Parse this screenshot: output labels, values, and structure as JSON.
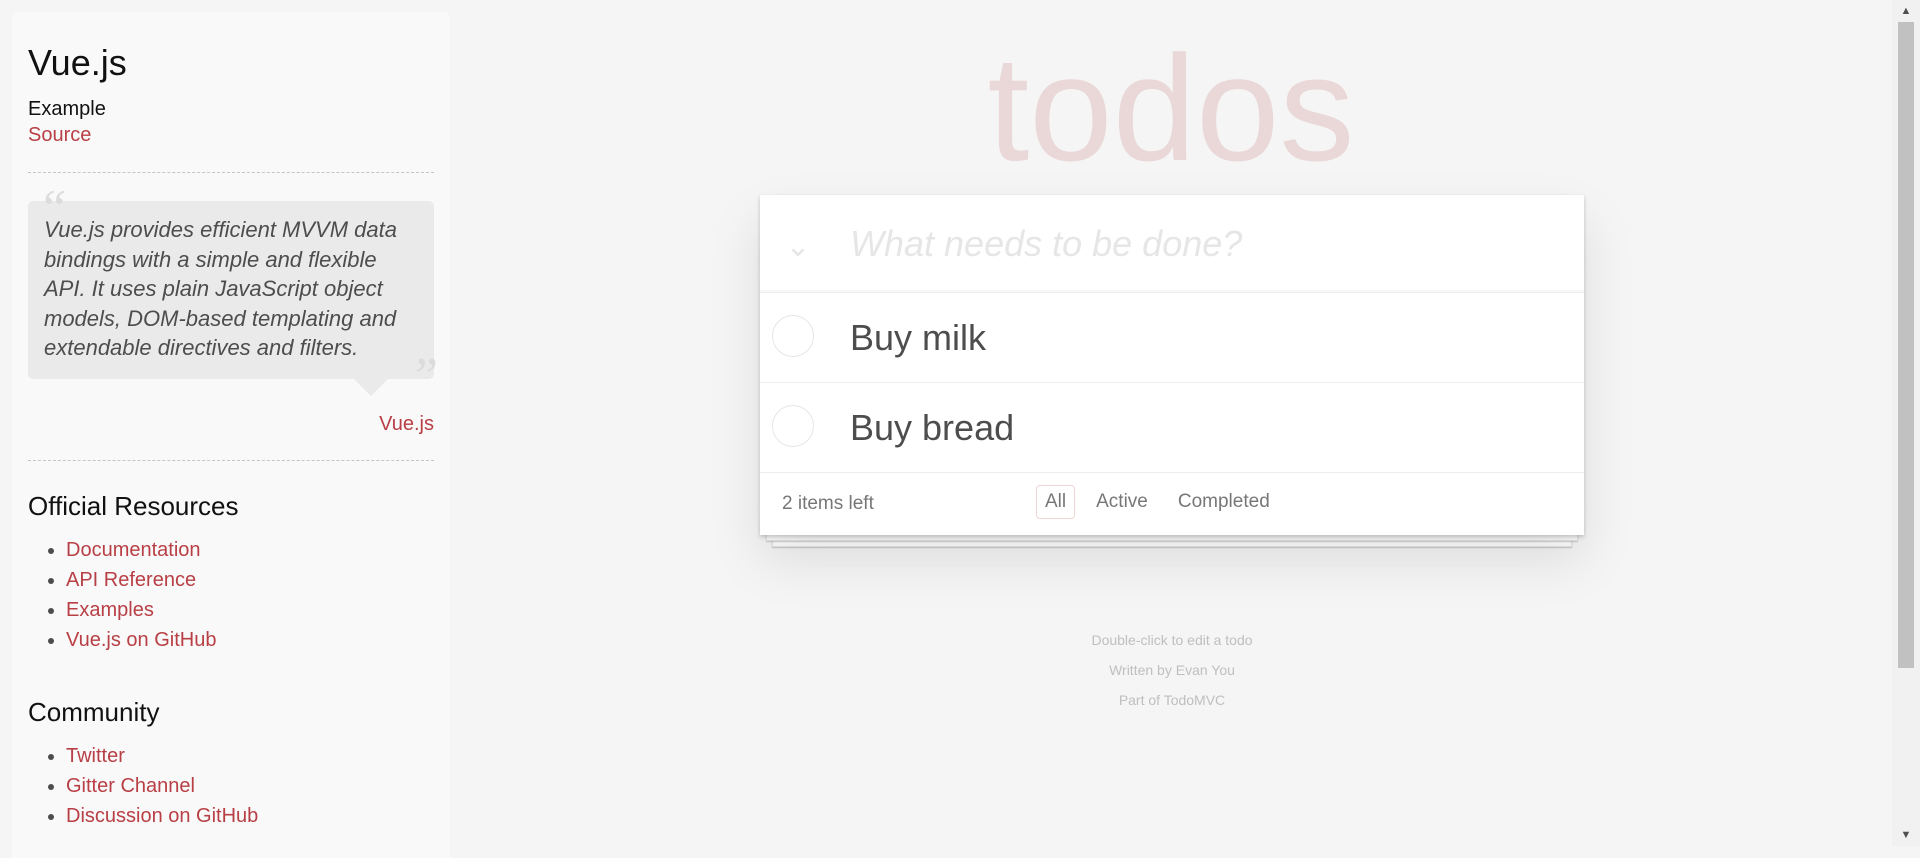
{
  "sidebar": {
    "title": "Vue.js",
    "example_label": "Example",
    "source_link": "Source",
    "quote": "Vue.js provides efficient MVVM data bindings with a simple and flexible API. It uses plain JavaScript object models, DOM-based templating and extendable directives and filters.",
    "quote_author": "Vue.js",
    "sections": [
      {
        "heading": "Official Resources",
        "links": [
          "Documentation",
          "API Reference",
          "Examples",
          "Vue.js on GitHub"
        ]
      },
      {
        "heading": "Community",
        "links": [
          "Twitter",
          "Gitter Channel",
          "Discussion on GitHub"
        ]
      }
    ]
  },
  "app": {
    "title": "todos",
    "new_todo_placeholder": "What needs to be done?",
    "todos": [
      {
        "label": "Buy milk",
        "completed": false
      },
      {
        "label": "Buy bread",
        "completed": false
      }
    ],
    "footer": {
      "count": "2 items left",
      "filters": [
        "All",
        "Active",
        "Completed"
      ],
      "selected_filter": "All"
    }
  },
  "info": {
    "line1": "Double-click to edit a todo",
    "line2": "Written by Evan You",
    "line3": "Part of TodoMVC"
  },
  "colors": {
    "accent": "#b83f45",
    "background": "#f5f5f5"
  }
}
